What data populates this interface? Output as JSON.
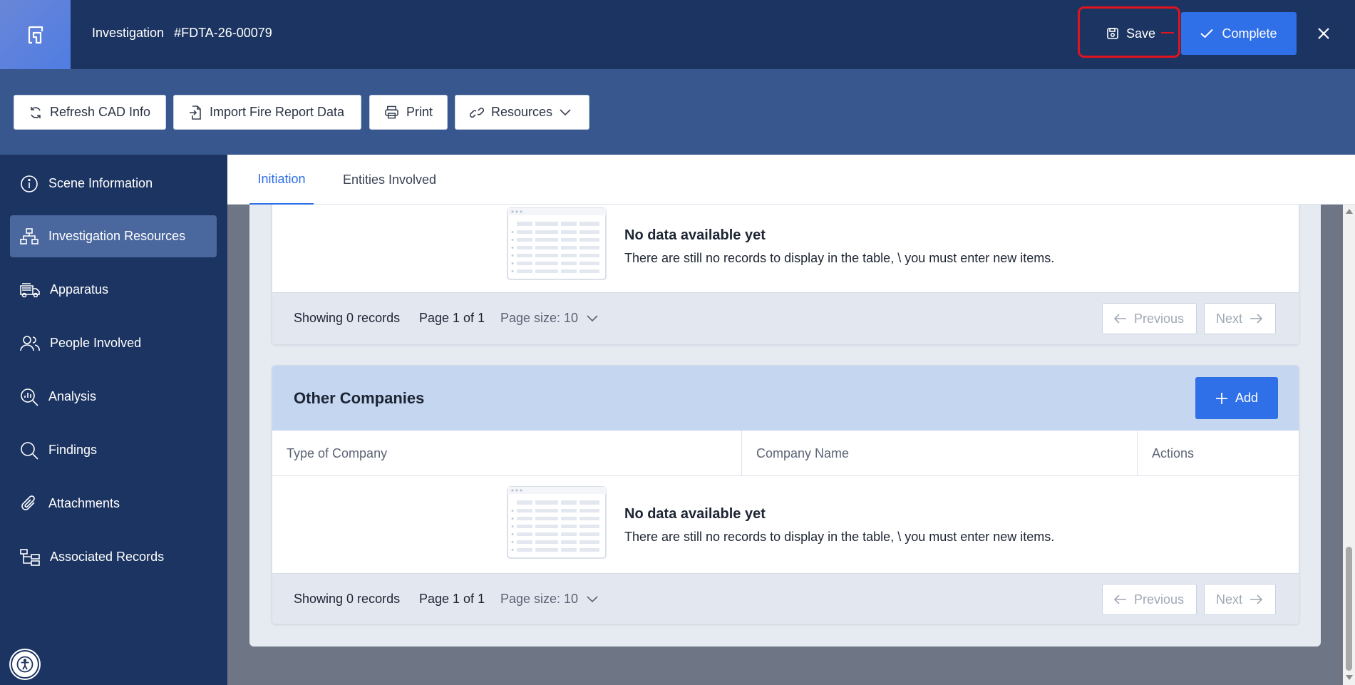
{
  "header": {
    "title": "Investigation",
    "reference": "#FDTA-26-00079",
    "save_label": "Save",
    "complete_label": "Complete",
    "highlight_color": "#e0141e"
  },
  "toolbar": {
    "refresh_label": "Refresh CAD Info",
    "import_label": "Import Fire Report Data",
    "print_label": "Print",
    "resources_label": "Resources"
  },
  "sidebar": {
    "items": [
      {
        "label": "Scene Information",
        "icon": "info-icon"
      },
      {
        "label": "Investigation Resources",
        "icon": "hierarchy-icon",
        "active": true
      },
      {
        "label": "Apparatus",
        "icon": "fire-truck-icon"
      },
      {
        "label": "People Involved",
        "icon": "people-icon"
      },
      {
        "label": "Analysis",
        "icon": "analysis-icon"
      },
      {
        "label": "Findings",
        "icon": "search-icon"
      },
      {
        "label": "Attachments",
        "icon": "paperclip-icon"
      },
      {
        "label": "Associated Records",
        "icon": "tree-icon"
      }
    ]
  },
  "tabs": [
    {
      "label": "Initiation",
      "active": true
    },
    {
      "label": "Entities Involved"
    }
  ],
  "panel1": {
    "empty_title": "No data available yet",
    "empty_desc": "There are still no records to display in the table, \\ you must enter new items.",
    "showing": "Showing 0 records",
    "page": "Page 1 of 1",
    "page_size": "Page size: 10",
    "previous": "Previous",
    "next": "Next"
  },
  "panel2": {
    "title": "Other Companies",
    "add_label": "Add",
    "columns": [
      "Type of Company",
      "Company Name",
      "Actions"
    ],
    "empty_title": "No data available yet",
    "empty_desc": "There are still no records to display in the table, \\ you must enter new items.",
    "showing": "Showing 0 records",
    "page": "Page 1 of 1",
    "page_size": "Page size: 10",
    "previous": "Previous",
    "next": "Next"
  },
  "colors": {
    "header_bg": "#1c3461",
    "toolbar_bg": "#38578f",
    "accent": "#2f6fe8",
    "panel_header": "#c5d7f0"
  }
}
